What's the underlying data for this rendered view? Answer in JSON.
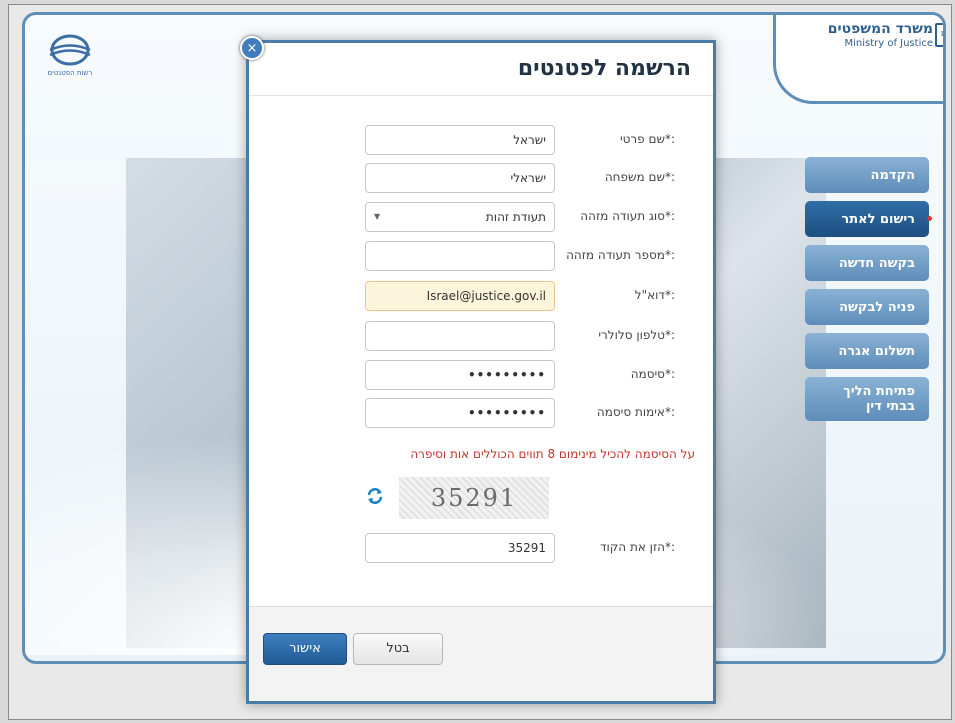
{
  "site": {
    "ministry_he": "משרד המשפטים",
    "ministry_en": "Ministry of Justice",
    "patent_logo_text": "רשות הפטנטים"
  },
  "side_menu": [
    {
      "label": "הקדמה",
      "active": false
    },
    {
      "label": "רישום לאתר",
      "active": true
    },
    {
      "label": "בקשה חדשה",
      "active": false
    },
    {
      "label": "פניה לבקשה",
      "active": false
    },
    {
      "label": "תשלום אגרה",
      "active": false
    },
    {
      "label": "פתיחת הליך בבתי דין",
      "active": false
    }
  ],
  "modal": {
    "title": "הרשמה לפטנטים",
    "close_icon": "×",
    "fields": {
      "first_name": {
        "label": "שם פרטי*:",
        "value": "ישראל"
      },
      "last_name": {
        "label": "שם משפחה*:",
        "value": "ישראלי"
      },
      "id_type": {
        "label": "סוג תעודה מזהה*:",
        "value": "תעודת זהות"
      },
      "id_number": {
        "label": "מספר תעודה מזהה*:",
        "value": ""
      },
      "email": {
        "label": "דוא\"ל*:",
        "value": "Israel@justice.gov.il"
      },
      "mobile": {
        "label": "טלפון סלולרי*:",
        "value": ""
      },
      "password": {
        "label": "סיסמה*:",
        "value": "•••••••••"
      },
      "password_confirm": {
        "label": "אימות סיסמה*:",
        "value": "•••••••••"
      },
      "captcha_code": {
        "label": "הזן את הקוד*:",
        "value": "35291"
      }
    },
    "error_message": "על הסיסמה להכיל מינימום 8 תווים הכוללים אות וסיפרה",
    "captcha_text": "35291",
    "cancel_label": "בטל",
    "ok_label": "אישור"
  }
}
